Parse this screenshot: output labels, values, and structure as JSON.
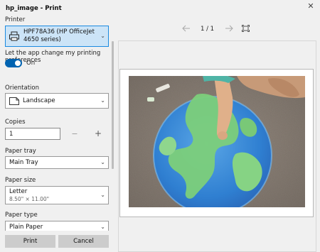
{
  "window": {
    "title": "hp_image - Print",
    "close_icon": "close-icon"
  },
  "printer": {
    "label": "Printer",
    "name": "HPF78A36 (HP OfficeJet 4650 series)",
    "icon": "printer-icon"
  },
  "preferences": {
    "label": "Let the app change my printing preferences",
    "toggle_state": "On"
  },
  "orientation": {
    "label": "Orientation",
    "value": "Landscape",
    "icon": "landscape-page-icon"
  },
  "copies": {
    "label": "Copies",
    "value": "1",
    "minus": "−",
    "plus": "+"
  },
  "paper_tray": {
    "label": "Paper tray",
    "value": "Main Tray"
  },
  "paper_size": {
    "label": "Paper size",
    "value": "Letter",
    "detail": "8.50\" × 11.00\""
  },
  "paper_type": {
    "label": "Paper type",
    "value": "Plain Paper"
  },
  "buttons": {
    "print": "Print",
    "cancel": "Cancel"
  },
  "preview": {
    "page_indicator": "1 / 1",
    "prev_icon": "arrow-left-icon",
    "next_icon": "arrow-right-icon",
    "fit_icon": "fit-page-icon",
    "image_desc": "child-drawing-earth-chalk-photo"
  },
  "colors": {
    "accent": "#0063b1",
    "selected_bg": "#cce4f7",
    "button_bg": "#cccccc"
  }
}
